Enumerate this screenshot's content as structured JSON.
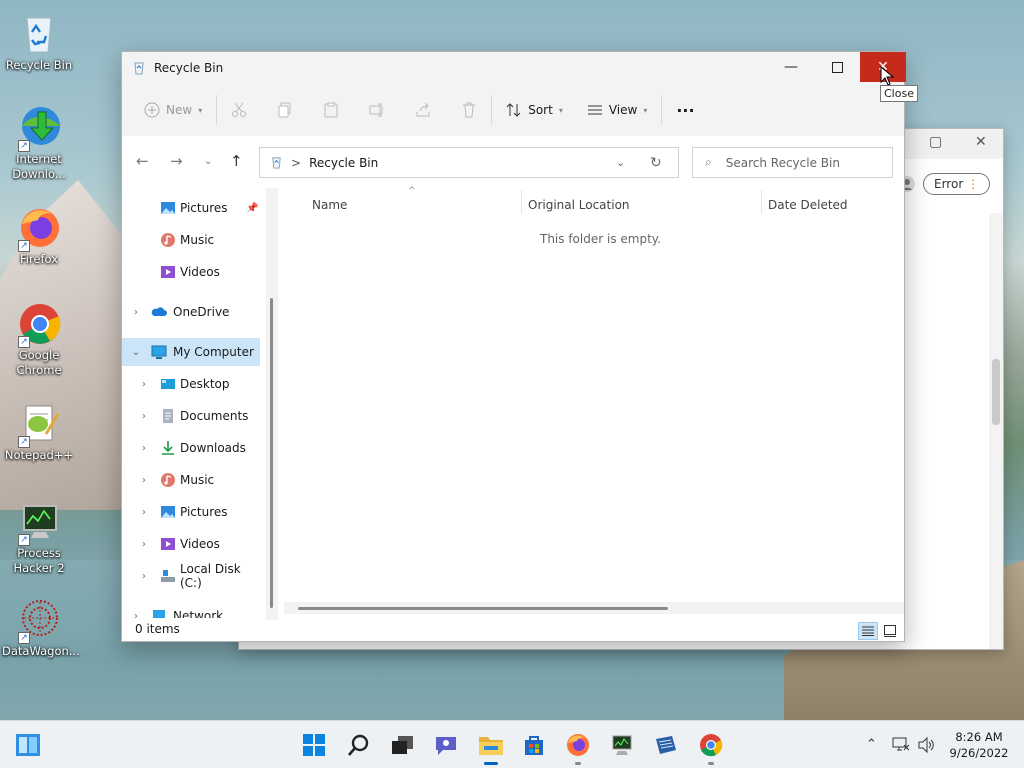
{
  "desktop": {
    "icons": [
      {
        "label": "Recycle Bin",
        "icon": "recycle-bin-icon"
      },
      {
        "label": "Internet Downlo...",
        "icon": "internet-download-manager-icon"
      },
      {
        "label": "Firefox",
        "icon": "firefox-icon"
      },
      {
        "label": "Google Chrome",
        "icon": "chrome-icon"
      },
      {
        "label": "Notepad++",
        "icon": "notepad-plus-plus-icon"
      },
      {
        "label": "Process Hacker 2",
        "icon": "process-hacker-icon"
      },
      {
        "label": "DataWagon...",
        "icon": "datawagon-icon"
      }
    ]
  },
  "background_window": {
    "error_label": "Error"
  },
  "window": {
    "title": "Recycle Bin",
    "tooltip": "Close",
    "toolbar": {
      "new_label": "New",
      "sort_label": "Sort",
      "view_label": "View",
      "more_label": "···"
    },
    "address": {
      "separator": ">",
      "location": "Recycle Bin",
      "search_placeholder": "Search Recycle Bin"
    },
    "nav": {
      "items": [
        {
          "label": "Pictures"
        },
        {
          "label": "Music"
        },
        {
          "label": "Videos"
        },
        {
          "label": "OneDrive"
        },
        {
          "label": "My Computer"
        },
        {
          "label": "Desktop"
        },
        {
          "label": "Documents"
        },
        {
          "label": "Downloads"
        },
        {
          "label": "Music"
        },
        {
          "label": "Pictures"
        },
        {
          "label": "Videos"
        },
        {
          "label": "Local Disk (C:)"
        },
        {
          "label": "Network"
        }
      ]
    },
    "columns": [
      "Name",
      "Original Location",
      "Date Deleted"
    ],
    "empty_message": "This folder is empty.",
    "status": "0 items"
  },
  "taskbar": {
    "time": "8:26 AM",
    "date": "9/26/2022"
  },
  "colors": {
    "accent": "#0067c0",
    "close_red": "#c42b1c",
    "selection": "#cce4f7"
  }
}
